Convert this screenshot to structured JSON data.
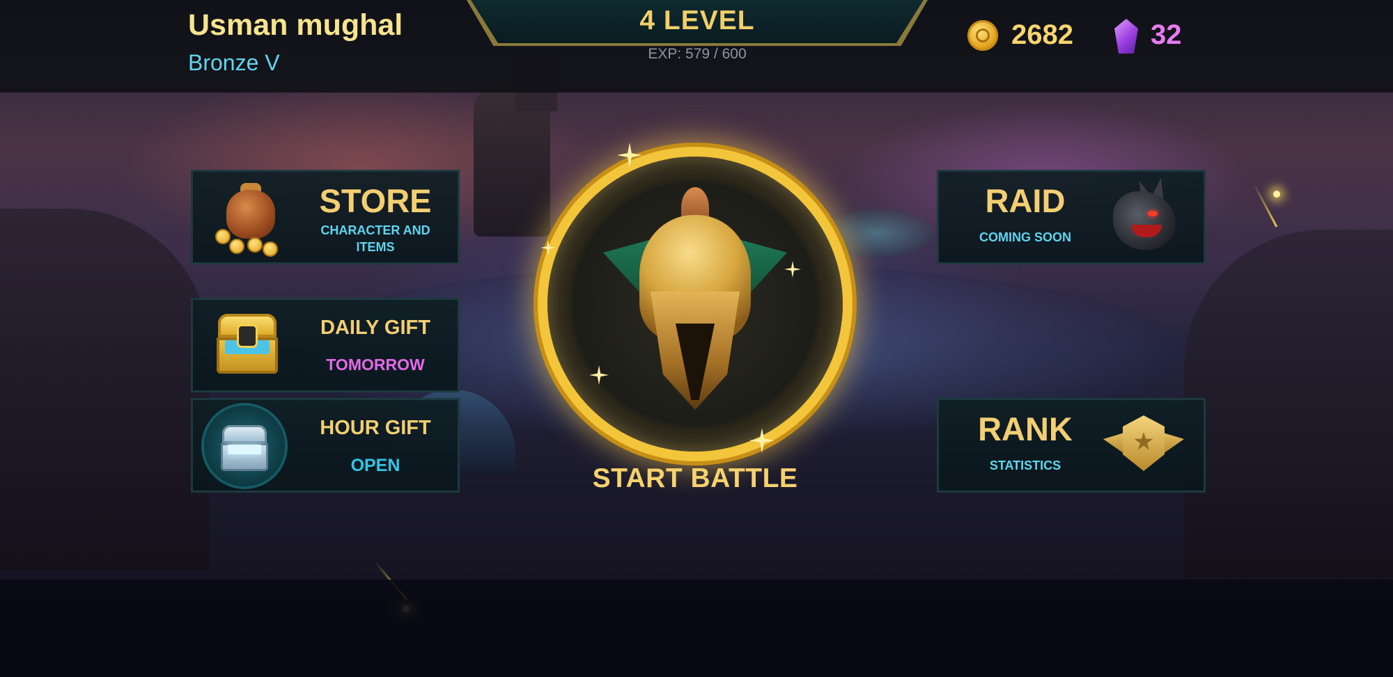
{
  "player": {
    "name": "Usman mughal",
    "rank": "Bronze V"
  },
  "level": {
    "label": "4  LEVEL",
    "exp_text": "EXP: 579 / 600",
    "exp_current": 579,
    "exp_max": 600
  },
  "currency": {
    "coins": "2682",
    "gems": "32",
    "coin_icon": "gold-coin-icon",
    "gem_icon": "purple-gem-icon"
  },
  "menu": {
    "store": {
      "title": "STORE",
      "subtitle": "CHARACTER AND ITEMS",
      "icon": "coin-bag-icon"
    },
    "daily_gift": {
      "title": "DAILY GIFT",
      "status": "TOMORROW",
      "icon": "gold-chest-icon"
    },
    "hour_gift": {
      "title": "HOUR GIFT",
      "status": "OPEN",
      "icon": "silver-chest-icon"
    },
    "raid": {
      "title": "RAID",
      "subtitle": "COMING SOON",
      "icon": "dragon-icon"
    },
    "rank": {
      "title": "RANK",
      "subtitle": "STATISTICS",
      "icon": "rank-badge-icon"
    }
  },
  "battle": {
    "label": "START BATTLE",
    "icon": "golden-helmet-icon"
  },
  "colors": {
    "gold_text": "#f3cf72",
    "cyan_text": "#5fd6ee",
    "pink_text": "#e36be6",
    "gem_text": "#e67cf2",
    "panel_bg": "#0f1e24",
    "panel_border": "#1d3940"
  }
}
